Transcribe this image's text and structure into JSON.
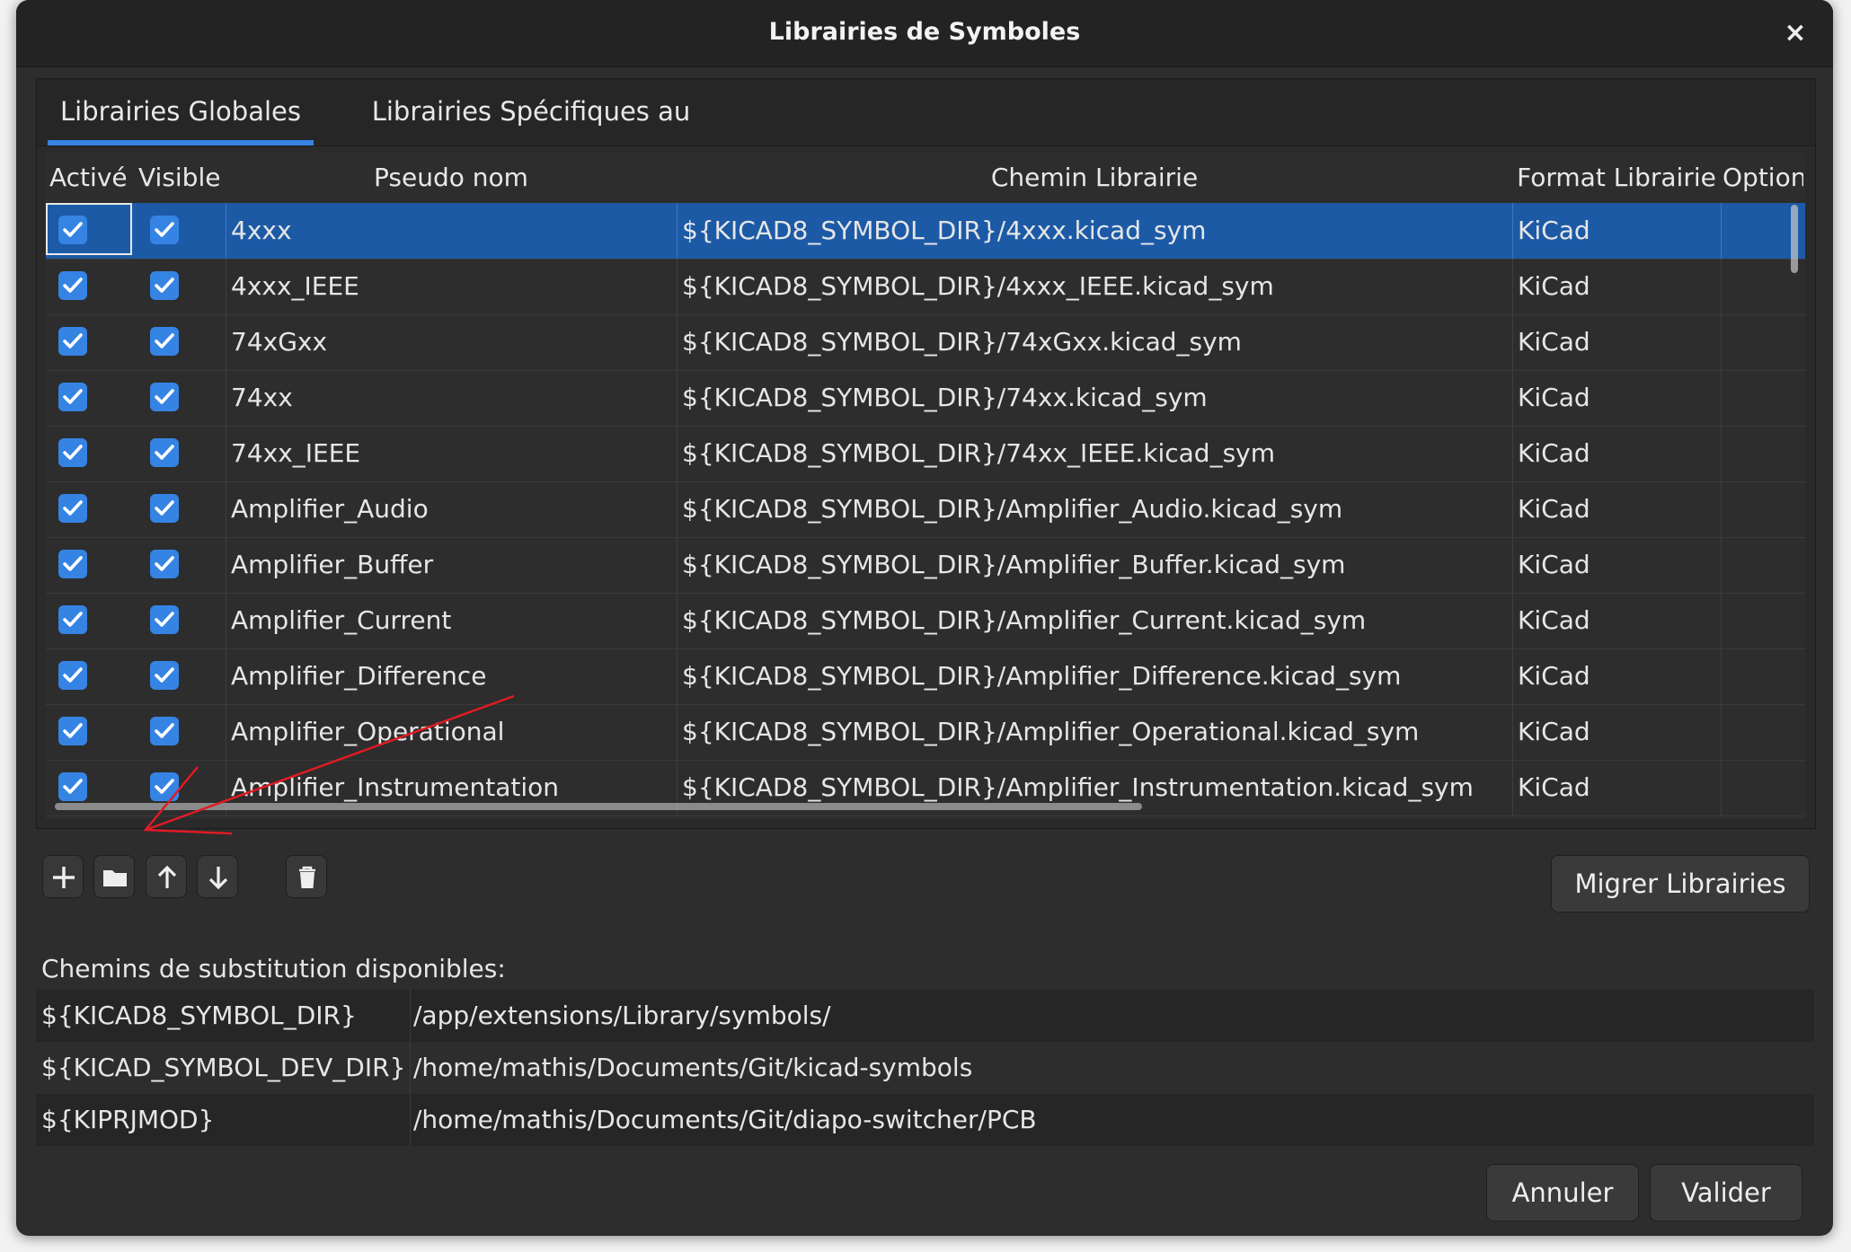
{
  "window": {
    "title": "Librairies de Symboles",
    "close_glyph": "×"
  },
  "tabs": [
    {
      "label": "Librairies Globales",
      "active": true
    },
    {
      "label": "Librairies Spécifiques au Projet",
      "active": false
    }
  ],
  "grid": {
    "headers": {
      "active": "Activé",
      "visible": "Visible",
      "nickname": "Pseudo nom",
      "path": "Chemin Librairie",
      "format": "Format Librairie",
      "options": "Options"
    },
    "rows": [
      {
        "active": true,
        "visible": true,
        "nickname": "4xxx",
        "path": "${KICAD8_SYMBOL_DIR}/4xxx.kicad_sym",
        "format": "KiCad",
        "options": "",
        "selected": true
      },
      {
        "active": true,
        "visible": true,
        "nickname": "4xxx_IEEE",
        "path": "${KICAD8_SYMBOL_DIR}/4xxx_IEEE.kicad_sym",
        "format": "KiCad",
        "options": ""
      },
      {
        "active": true,
        "visible": true,
        "nickname": "74xGxx",
        "path": "${KICAD8_SYMBOL_DIR}/74xGxx.kicad_sym",
        "format": "KiCad",
        "options": ""
      },
      {
        "active": true,
        "visible": true,
        "nickname": "74xx",
        "path": "${KICAD8_SYMBOL_DIR}/74xx.kicad_sym",
        "format": "KiCad",
        "options": ""
      },
      {
        "active": true,
        "visible": true,
        "nickname": "74xx_IEEE",
        "path": "${KICAD8_SYMBOL_DIR}/74xx_IEEE.kicad_sym",
        "format": "KiCad",
        "options": ""
      },
      {
        "active": true,
        "visible": true,
        "nickname": "Amplifier_Audio",
        "path": "${KICAD8_SYMBOL_DIR}/Amplifier_Audio.kicad_sym",
        "format": "KiCad",
        "options": ""
      },
      {
        "active": true,
        "visible": true,
        "nickname": "Amplifier_Buffer",
        "path": "${KICAD8_SYMBOL_DIR}/Amplifier_Buffer.kicad_sym",
        "format": "KiCad",
        "options": ""
      },
      {
        "active": true,
        "visible": true,
        "nickname": "Amplifier_Current",
        "path": "${KICAD8_SYMBOL_DIR}/Amplifier_Current.kicad_sym",
        "format": "KiCad",
        "options": ""
      },
      {
        "active": true,
        "visible": true,
        "nickname": "Amplifier_Difference",
        "path": "${KICAD8_SYMBOL_DIR}/Amplifier_Difference.kicad_sym",
        "format": "KiCad",
        "options": ""
      },
      {
        "active": true,
        "visible": true,
        "nickname": "Amplifier_Operational",
        "path": "${KICAD8_SYMBOL_DIR}/Amplifier_Operational.kicad_sym",
        "format": "KiCad",
        "options": ""
      },
      {
        "active": true,
        "visible": true,
        "nickname": "Amplifier_Instrumentation",
        "path": "${KICAD8_SYMBOL_DIR}/Amplifier_Instrumentation.kicad_sym",
        "format": "KiCad",
        "options": ""
      }
    ]
  },
  "toolbar": {
    "add_icon": "plus-icon",
    "browse_icon": "folder-icon",
    "move_up_icon": "arrow-up-icon",
    "move_down_icon": "arrow-down-icon",
    "delete_icon": "trash-icon",
    "migrate_label": "Migrer Librairies"
  },
  "substitutions": {
    "label": "Chemins de substitution disponibles:",
    "rows": [
      {
        "name": "${KICAD8_SYMBOL_DIR}",
        "value": "/app/extensions/Library/symbols/"
      },
      {
        "name": "${KICAD_SYMBOL_DEV_DIR}",
        "value": "/home/mathis/Documents/Git/kicad-symbols"
      },
      {
        "name": "${KIPRJMOD}",
        "value": "/home/mathis/Documents/Git/diapo-switcher/PCB"
      }
    ]
  },
  "footer": {
    "cancel_label": "Annuler",
    "ok_label": "Valider"
  },
  "colors": {
    "accent": "#3584e4",
    "selection": "#1c5aa6",
    "background": "#2d2d2d",
    "annotation": "#e01b24"
  }
}
